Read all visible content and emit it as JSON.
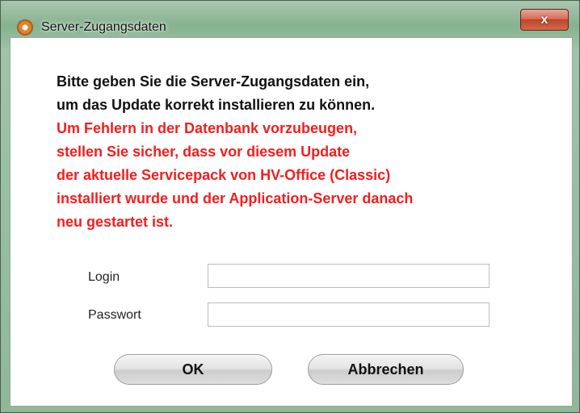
{
  "window": {
    "title": "Server-Zugangsdaten",
    "close_symbol": "x",
    "app_icon": "hv-office-app-icon",
    "close_icon": "close-icon"
  },
  "message": {
    "black_lines": [
      "Bitte geben Sie die Server-Zugangsdaten ein,",
      "um das Update korrekt installieren zu können."
    ],
    "red_lines": [
      "Um Fehlern in der Datenbank vorzubeugen,",
      "stellen Sie sicher, dass vor diesem Update",
      "der aktuelle Servicepack von HV-Office (Classic)",
      "installiert wurde und der Application-Server danach",
      "neu gestartet ist."
    ]
  },
  "form": {
    "login_label": "Login",
    "login_value": "",
    "password_label": "Passwort",
    "password_value": ""
  },
  "buttons": {
    "ok": "OK",
    "cancel": "Abbrechen"
  },
  "colors": {
    "warning_text": "#f41d1d",
    "close_button": "#c04326"
  }
}
